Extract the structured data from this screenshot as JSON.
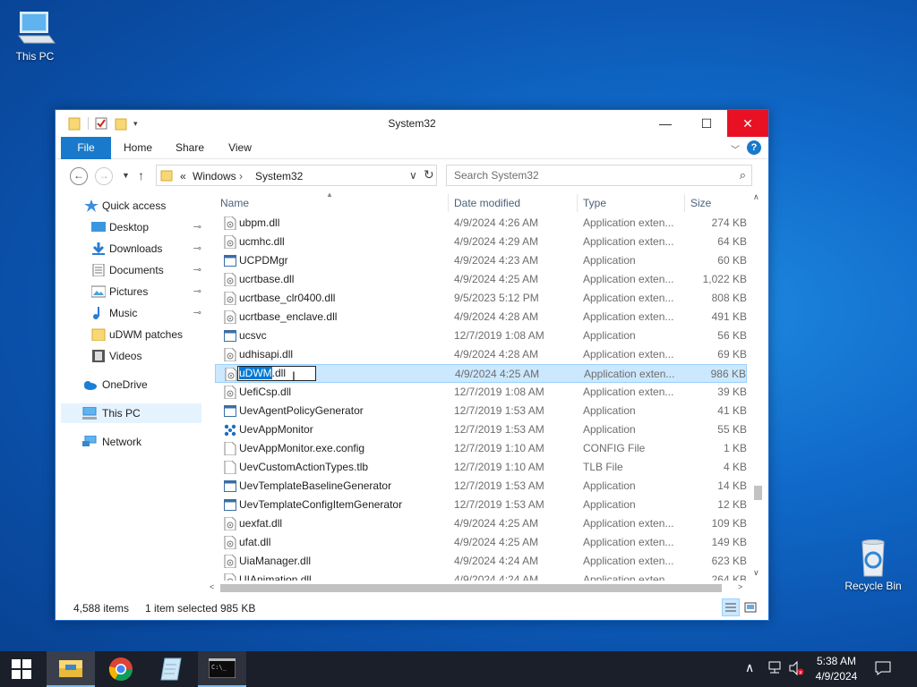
{
  "desktop": {
    "this_pc_label": "This PC",
    "recycle_bin_label": "Recycle Bin"
  },
  "window": {
    "title": "System32",
    "minimize_glyph": "—",
    "maximize_glyph": "☐",
    "close_glyph": "✕"
  },
  "ribbon": {
    "file": "File",
    "home": "Home",
    "share": "Share",
    "view": "View",
    "expand_glyph": "﹀",
    "help_glyph": "?"
  },
  "address": {
    "back_glyph": "←",
    "forward_glyph": "→",
    "recent_glyph": "▼",
    "up_glyph": "↑",
    "overflow": "«",
    "crumbs": [
      "Windows",
      "System32"
    ],
    "separator": "›",
    "dropdown_glyph": "∨",
    "refresh_glyph": "↻"
  },
  "search": {
    "placeholder": "Search System32",
    "icon": "search-icon",
    "glyph": "⌕"
  },
  "nav": {
    "quick_access": "Quick access",
    "items": [
      {
        "label": "Desktop",
        "pinned": true
      },
      {
        "label": "Downloads",
        "pinned": true
      },
      {
        "label": "Documents",
        "pinned": true
      },
      {
        "label": "Pictures",
        "pinned": true
      },
      {
        "label": "Music",
        "pinned": true
      },
      {
        "label": "uDWM patches",
        "pinned": false
      },
      {
        "label": "Videos",
        "pinned": false
      }
    ],
    "onedrive": "OneDrive",
    "this_pc": "This PC",
    "network": "Network",
    "pin_glyph": "📌"
  },
  "columns": {
    "name": "Name",
    "date": "Date modified",
    "type": "Type",
    "size": "Size",
    "sort_glyph": "▲"
  },
  "files": [
    {
      "name": "ubpm.dll",
      "date": "4/9/2024 4:26 AM",
      "type": "Application exten...",
      "size": "274 KB",
      "icon": "dll"
    },
    {
      "name": "ucmhc.dll",
      "date": "4/9/2024 4:29 AM",
      "type": "Application exten...",
      "size": "64 KB",
      "icon": "dll"
    },
    {
      "name": "UCPDMgr",
      "date": "4/9/2024 4:23 AM",
      "type": "Application",
      "size": "60 KB",
      "icon": "exe"
    },
    {
      "name": "ucrtbase.dll",
      "date": "4/9/2024 4:25 AM",
      "type": "Application exten...",
      "size": "1,022 KB",
      "icon": "dll"
    },
    {
      "name": "ucrtbase_clr0400.dll",
      "date": "9/5/2023 5:12 PM",
      "type": "Application exten...",
      "size": "808 KB",
      "icon": "dll"
    },
    {
      "name": "ucrtbase_enclave.dll",
      "date": "4/9/2024 4:28 AM",
      "type": "Application exten...",
      "size": "491 KB",
      "icon": "dll"
    },
    {
      "name": "ucsvc",
      "date": "12/7/2019 1:08 AM",
      "type": "Application",
      "size": "56 KB",
      "icon": "exe"
    },
    {
      "name": "udhisapi.dll",
      "date": "4/9/2024 4:28 AM",
      "type": "Application exten...",
      "size": "69 KB",
      "icon": "dll"
    },
    {
      "name": "uDWM.dll",
      "date": "4/9/2024 4:25 AM",
      "type": "Application exten...",
      "size": "986 KB",
      "icon": "dll"
    },
    {
      "name": "UefiCsp.dll",
      "date": "12/7/2019 1:08 AM",
      "type": "Application exten...",
      "size": "39 KB",
      "icon": "dll"
    },
    {
      "name": "UevAgentPolicyGenerator",
      "date": "12/7/2019 1:53 AM",
      "type": "Application",
      "size": "41 KB",
      "icon": "exe"
    },
    {
      "name": "UevAppMonitor",
      "date": "12/7/2019 1:53 AM",
      "type": "Application",
      "size": "55 KB",
      "icon": "uev"
    },
    {
      "name": "UevAppMonitor.exe.config",
      "date": "12/7/2019 1:10 AM",
      "type": "CONFIG File",
      "size": "1 KB",
      "icon": "file"
    },
    {
      "name": "UevCustomActionTypes.tlb",
      "date": "12/7/2019 1:10 AM",
      "type": "TLB File",
      "size": "4 KB",
      "icon": "file"
    },
    {
      "name": "UevTemplateBaselineGenerator",
      "date": "12/7/2019 1:53 AM",
      "type": "Application",
      "size": "14 KB",
      "icon": "exe"
    },
    {
      "name": "UevTemplateConfigItemGenerator",
      "date": "12/7/2019 1:53 AM",
      "type": "Application",
      "size": "12 KB",
      "icon": "exe"
    },
    {
      "name": "uexfat.dll",
      "date": "4/9/2024 4:25 AM",
      "type": "Application exten...",
      "size": "109 KB",
      "icon": "dll"
    },
    {
      "name": "ufat.dll",
      "date": "4/9/2024 4:25 AM",
      "type": "Application exten...",
      "size": "149 KB",
      "icon": "dll"
    },
    {
      "name": "UiaManager.dll",
      "date": "4/9/2024 4:24 AM",
      "type": "Application exten...",
      "size": "623 KB",
      "icon": "dll"
    },
    {
      "name": "UIAnimation.dll",
      "date": "4/9/2024 4:24 AM",
      "type": "Application exten...",
      "size": "264 KB",
      "icon": "dll"
    }
  ],
  "rename": {
    "selected_part": "uDWM",
    "rest": ".dll",
    "cursor_glyph": "I"
  },
  "scroll": {
    "up_glyph": "∧",
    "down_glyph": "∨",
    "left_glyph": "<",
    "right_glyph": ">"
  },
  "status": {
    "items": "4,588 items",
    "selected": "1 item selected",
    "size": "985 KB"
  },
  "taskbar": {
    "chevron_glyph": "∧",
    "time": "5:38 AM",
    "date": "4/9/2024"
  },
  "colors": {
    "accent": "#1979ca",
    "selection": "#cce8ff",
    "close": "#e81123",
    "taskbar": "#1a1f2a"
  }
}
